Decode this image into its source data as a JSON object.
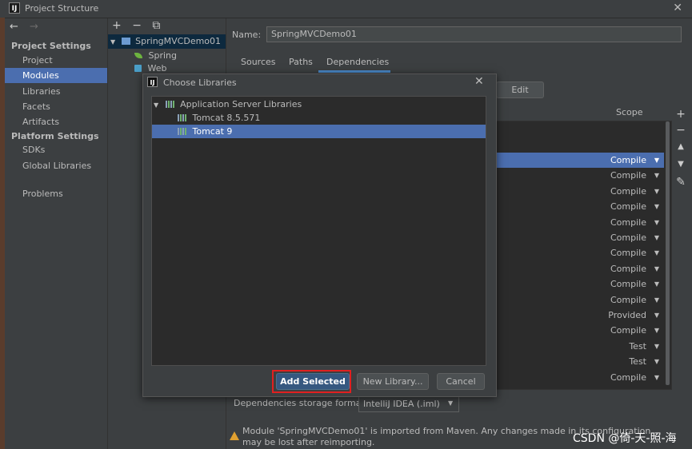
{
  "window": {
    "title": "Project Structure",
    "close_glyph": "✕",
    "app_icon": "IJ"
  },
  "nav": {
    "back_glyph": "←",
    "forward_glyph": "→",
    "project_settings_heading": "Project Settings",
    "project_settings_items": [
      "Project",
      "Modules",
      "Libraries",
      "Facets",
      "Artifacts"
    ],
    "platform_settings_heading": "Platform Settings",
    "platform_settings_items": [
      "SDKs",
      "Global Libraries"
    ],
    "other_items": [
      "Problems"
    ],
    "selected": "Modules"
  },
  "module_tree": {
    "toolbar": [
      "+",
      "−",
      "⧉"
    ],
    "root": "SpringMVCDemo01",
    "children": [
      "Spring",
      "Web"
    ]
  },
  "module_editor": {
    "name_label": "Name:",
    "name_value": "SpringMVCDemo01",
    "tabs": [
      "Sources",
      "Paths",
      "Dependencies"
    ],
    "active_tab": "Dependencies",
    "edit_button": "Edit",
    "scope_header": "Scope",
    "scopes": [
      "Compile",
      "Compile",
      "Compile",
      "Compile",
      "Compile",
      "Compile",
      "Compile",
      "Compile",
      "Compile",
      "Compile",
      "Provided",
      "Compile",
      "Test",
      "Test",
      "Compile"
    ],
    "side_tools": [
      "+",
      "−",
      "▲",
      "▼",
      "✎"
    ],
    "storage_format_label": "Dependencies storage format:",
    "storage_format_value": "IntelliJ IDEA (.iml)",
    "warning_text": "Module 'SpringMVCDemo01' is imported from Maven. Any changes made in its configuration may be lost after reimporting."
  },
  "dialog": {
    "title": "Choose Libraries",
    "close_glyph": "✕",
    "group": "Application Server Libraries",
    "libraries": [
      "Tomcat 8.5.571",
      "Tomcat 9"
    ],
    "selected_library": "Tomcat 9",
    "buttons": {
      "add_selected": "Add Selected",
      "new_library": "New Library...",
      "cancel": "Cancel"
    }
  },
  "watermark": "CSDN @倚-天-照-海"
}
